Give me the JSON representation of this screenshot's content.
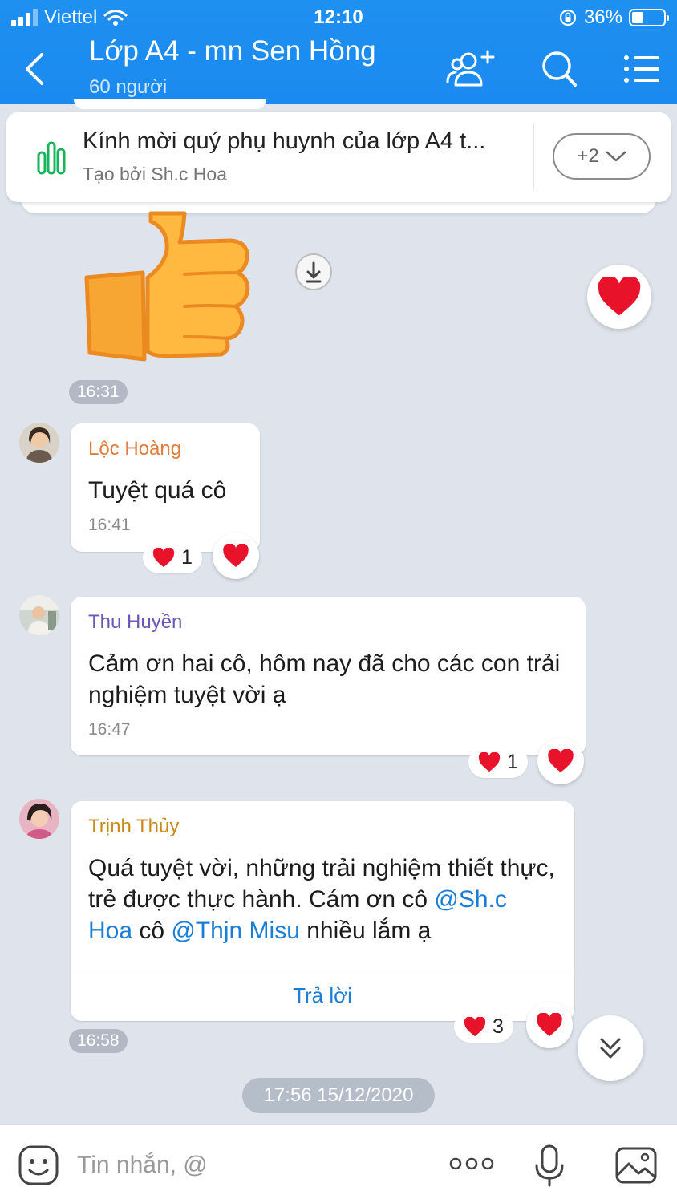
{
  "status_bar": {
    "carrier": "Viettel",
    "time": "12:10",
    "battery": "36%",
    "battery_level": 0.36
  },
  "header": {
    "title": "Lớp A4 - mn Sen Hồng",
    "subtitle": "60 người"
  },
  "pinned": {
    "title": "Kính mời quý phụ huynh của lớp A4 t...",
    "creator": "Tạo bởi Sh.c Hoa",
    "more": "+2"
  },
  "sticker_time": "16:31",
  "messages": [
    {
      "sender": "Lộc Hoàng",
      "sender_color": "#e07b39",
      "text": "Tuyệt quá cô",
      "time": "16:41",
      "reactions": "1"
    },
    {
      "sender": "Thu Huyền",
      "sender_color": "#6b57b5",
      "text": "Cảm ơn hai cô, hôm nay đã cho các con trải nghiệm tuyệt vời ạ",
      "time": "16:47",
      "reactions": "1"
    },
    {
      "sender": "Trịnh Thủy",
      "sender_color": "#c78a16",
      "text_before": "Quá tuyệt vời, những trải nghiệm thiết thực, trẻ được thực hành. Cám ơn cô ",
      "mention_1": "@Sh.c Hoa",
      "text_mid": " cô ",
      "mention_2": "@Thjn Misu",
      "text_after": " nhiều lắm ạ",
      "reply": "Trả lời",
      "time": "16:58",
      "reactions": "3"
    }
  ],
  "date_separator": "17:56 15/12/2020",
  "input": {
    "placeholder": "Tin nhắn, @"
  },
  "colors": {
    "header": "#1b8af0",
    "accent": "#1a7ed6",
    "heart": "#e8132b",
    "background": "#dfe4ec"
  }
}
